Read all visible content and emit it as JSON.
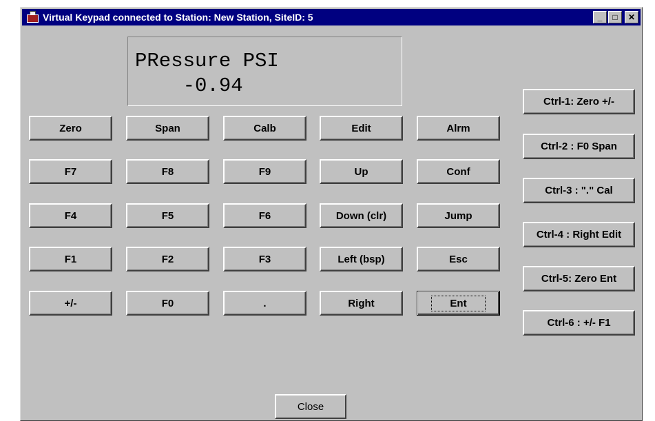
{
  "window": {
    "title": "Virtual Keypad connected to Station:  New Station, SiteID: 5",
    "minimize_glyph": "_",
    "maximize_glyph": "□",
    "close_glyph": "✕"
  },
  "display": {
    "line1": "PRessure PSI",
    "line2": "    -0.94"
  },
  "keypad": {
    "rows": [
      [
        "Zero",
        "Span",
        "Calb",
        "Edit",
        "Alrm"
      ],
      [
        "F7",
        "F8",
        "F9",
        "Up",
        "Conf"
      ],
      [
        "F4",
        "F5",
        "F6",
        "Down (clr)",
        "Jump"
      ],
      [
        "F1",
        "F2",
        "F3",
        "Left (bsp)",
        "Esc"
      ],
      [
        "+/-",
        "F0",
        ".",
        "Right",
        "Ent"
      ]
    ]
  },
  "shortcuts": [
    "Ctrl-1: Zero +/-",
    "Ctrl-2 : F0 Span",
    "Ctrl-3 : \".\" Cal",
    "Ctrl-4 : Right Edit",
    "Ctrl-5: Zero Ent",
    "Ctrl-6 : +/- F1"
  ],
  "close_label": "Close"
}
